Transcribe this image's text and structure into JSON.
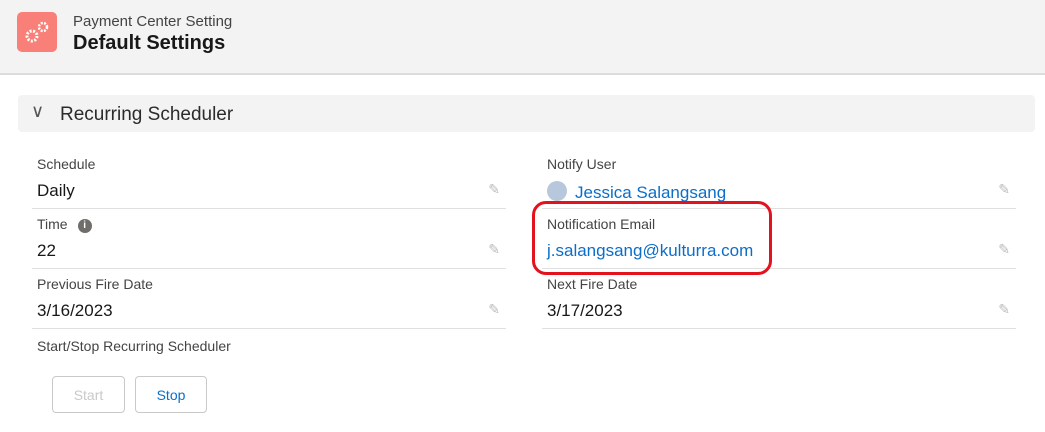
{
  "header": {
    "subtitle": "Payment Center Setting",
    "title": "Default Settings"
  },
  "section": {
    "title": "Recurring Scheduler"
  },
  "fields": {
    "schedule": {
      "label": "Schedule",
      "value": "Daily"
    },
    "notify_user": {
      "label": "Notify User",
      "value": "Jessica Salangsang"
    },
    "time": {
      "label": "Time",
      "value": "22"
    },
    "notification_email": {
      "label": "Notification Email",
      "value": "j.salangsang@kulturra.com"
    },
    "previous_fire_date": {
      "label": "Previous Fire Date",
      "value": "3/16/2023"
    },
    "next_fire_date": {
      "label": "Next Fire Date",
      "value": "3/17/2023"
    },
    "start_stop": {
      "label": "Start/Stop Recurring Scheduler"
    }
  },
  "buttons": {
    "start": "Start",
    "stop": "Stop"
  }
}
